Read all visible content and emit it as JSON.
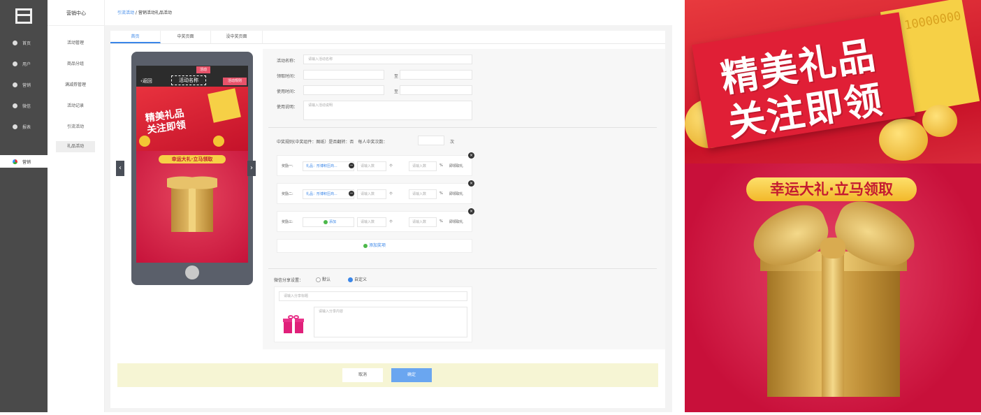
{
  "sidebar": {
    "items": [
      {
        "label": "首页",
        "icon": "home-icon"
      },
      {
        "label": "用户",
        "icon": "user-icon"
      },
      {
        "label": "营销",
        "icon": "marketing-icon"
      },
      {
        "label": "微信",
        "icon": "wechat-icon"
      },
      {
        "label": "报表",
        "icon": "report-icon"
      },
      {
        "label": "营销",
        "icon": "app-icon",
        "active": true
      }
    ]
  },
  "subnav": {
    "title": "营销中心",
    "items": [
      "活动管理",
      "商品分组",
      "满减券管理",
      "活动记录",
      "引流活动",
      "礼品活动"
    ],
    "active_index": 5
  },
  "breadcrumb": {
    "link": "引流活动",
    "separator": " / ",
    "current": "营销活动礼品活动"
  },
  "tabs": [
    "首页",
    "中奖页面",
    "没中奖页面"
  ],
  "phone": {
    "back": "返回",
    "title": "活动名称",
    "mini_button": "活动",
    "rule_button": "活动规则",
    "banner_line1": "精美礼品",
    "banner_line2": "关注即领",
    "pill": "幸运大礼·立马领取"
  },
  "form": {
    "name_label": "活动名称：",
    "name_placeholder": "请输入活动名称",
    "claim_label": "领取时间：",
    "use_label": "使用时间：",
    "to": "至",
    "desc_label": "使用说明：",
    "desc_placeholder": "请输入活动说明",
    "rule_text": "中奖规则(中奖组件：图纸）是否翻转：否　每人中奖次数：",
    "times_unit": "次",
    "prizes": [
      {
        "label": "奖励一:",
        "gift": "礼品：形博积压商...",
        "qty_placeholder": "请输入数",
        "unit": "个",
        "prob_placeholder": "请输入数",
        "percent": "%",
        "tail": "即领取礼"
      },
      {
        "label": "奖励二:",
        "gift": "礼品：形博积压商...",
        "qty_placeholder": "请输入数",
        "unit": "个",
        "prob_placeholder": "请输入数",
        "percent": "%",
        "tail": "即领取礼"
      },
      {
        "label": "奖励三:",
        "gift": "添加",
        "qty_placeholder": "请输入数",
        "unit": "个",
        "prob_placeholder": "请输入数",
        "percent": "%",
        "tail": "即领取礼"
      }
    ],
    "add_prize": "添加奖项",
    "share_label": "微信分享设置：",
    "share_default": "默认",
    "share_custom": "自定义",
    "share_title_placeholder": "请输入分享标题",
    "share_desc_placeholder": "请输入分享内容",
    "cancel": "取消",
    "confirm": "确定"
  },
  "preview": {
    "ticket_number": "10000000",
    "headline_line1": "精美礼品",
    "headline_line2": "关注即领",
    "pill": "幸运大礼·立马领取"
  },
  "colors": {
    "accent": "#3a86e8",
    "sidebar": "#4a4a4a",
    "promo_red": "#d8213b",
    "gold": "#f6d046"
  }
}
